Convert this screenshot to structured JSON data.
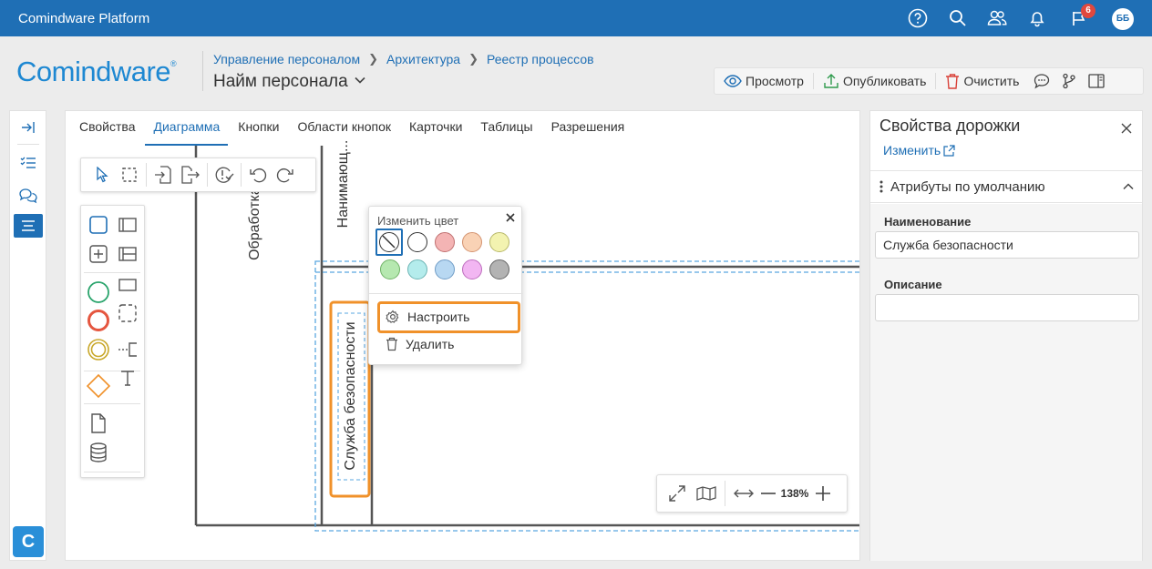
{
  "topbar": {
    "app_title": "Comindware Platform",
    "icons": [
      "help-icon",
      "search-icon",
      "users-icon",
      "bell-icon",
      "flag-icon"
    ],
    "notification_count": "6",
    "avatar_initials": "ББ"
  },
  "header": {
    "logo_text": "Comindware",
    "logo_mark": "®",
    "breadcrumb": [
      "Управление персоналом",
      "Архитектура",
      "Реестр процессов"
    ],
    "page_title": "Найм персонала",
    "actions": {
      "preview": "Просмотр",
      "publish": "Опубликовать",
      "clear": "Очистить"
    }
  },
  "left_rail": {
    "logo_letter": "C",
    "items": [
      "collapse-icon",
      "checklist-icon",
      "chat-icon",
      "list-icon"
    ]
  },
  "tabs": [
    {
      "label": "Свойства",
      "active": false
    },
    {
      "label": "Диаграмма",
      "active": true
    },
    {
      "label": "Кнопки",
      "active": false
    },
    {
      "label": "Области кнопок",
      "active": false
    },
    {
      "label": "Карточки",
      "active": false
    },
    {
      "label": "Таблицы",
      "active": false
    },
    {
      "label": "Разрешения",
      "active": false
    }
  ],
  "diagram": {
    "lanes": {
      "lane_left": "Обработка з...",
      "lane_mid": "Нанимающ...",
      "lane_selected": "Служба безопасности"
    },
    "colors": {
      "lane_border": "#555555",
      "selection": "#5aa7e0",
      "highlight": "#f0912a"
    }
  },
  "color_popup": {
    "title": "Изменить цвет",
    "swatches": [
      "none",
      "#ffffff",
      "#f4b4b4",
      "#f9d2b5",
      "#f3f3b0",
      "#b6e8b0",
      "#b4ecec",
      "#b8d8f2",
      "#f2b6f2",
      "#b3b3b3"
    ],
    "menu": {
      "configure": "Настроить",
      "delete": "Удалить"
    }
  },
  "zoom": {
    "level": "138%"
  },
  "right_panel": {
    "title": "Свойства дорожки",
    "edit_link": "Изменить",
    "section_title": "Атрибуты по умолчанию",
    "fields": {
      "name_label": "Наименование",
      "name_value": "Служба безопасности",
      "description_label": "Описание",
      "description_value": ""
    }
  }
}
